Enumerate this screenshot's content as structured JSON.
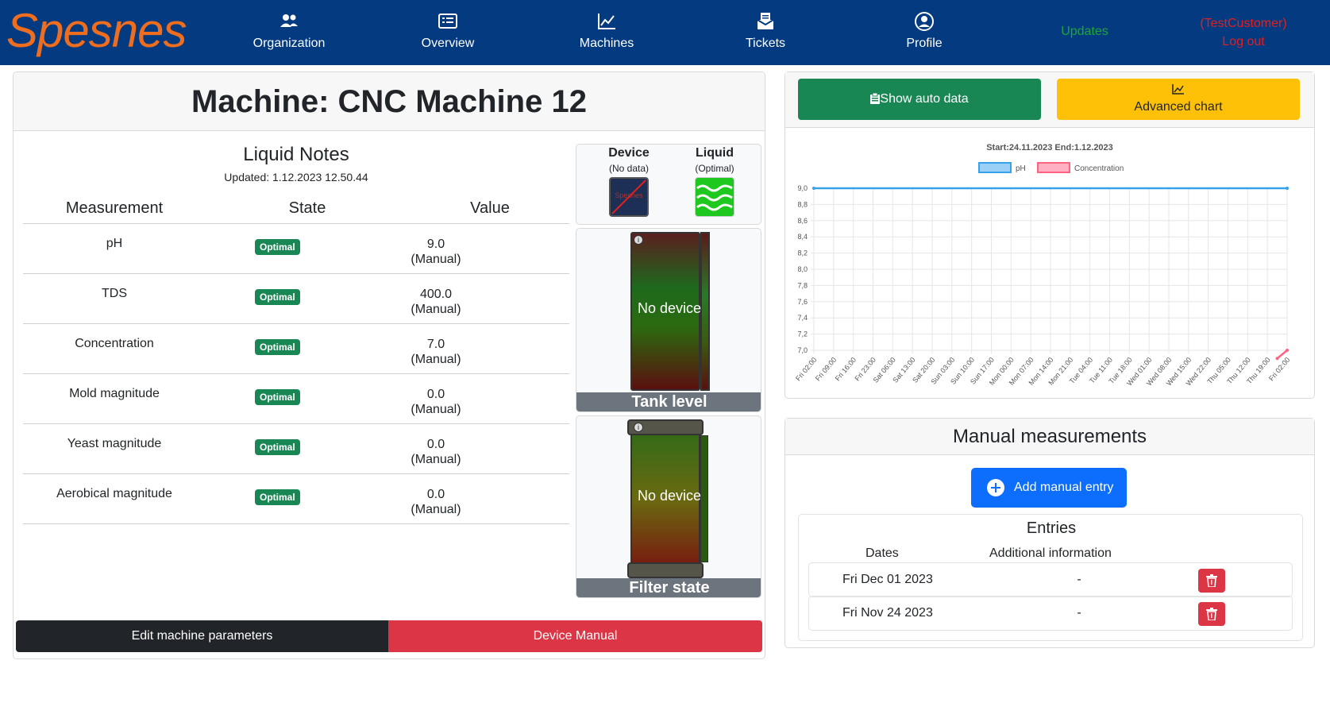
{
  "nav": {
    "brand": "Spesnes",
    "items": [
      {
        "label": "Organization",
        "icon": "users-icon"
      },
      {
        "label": "Overview",
        "icon": "list-card-icon"
      },
      {
        "label": "Machines",
        "icon": "line-chart-icon"
      },
      {
        "label": "Tickets",
        "icon": "ticket-icon"
      },
      {
        "label": "Profile",
        "icon": "user-circle-icon"
      }
    ],
    "updates": "Updates",
    "customer": "(TestCustomer)",
    "logout": "Log out"
  },
  "machine": {
    "title": "Machine: CNC Machine 12",
    "notes_title": "Liquid Notes",
    "updated": "Updated: 1.12.2023 12.50.44",
    "headers": {
      "measurement": "Measurement",
      "state": "State",
      "value": "Value"
    },
    "rows": [
      {
        "measurement": "pH",
        "state": "Optimal",
        "value": "9.0",
        "source": "(Manual)"
      },
      {
        "measurement": "TDS",
        "state": "Optimal",
        "value": "400.0",
        "source": "(Manual)"
      },
      {
        "measurement": "Concentration",
        "state": "Optimal",
        "value": "7.0",
        "source": "(Manual)"
      },
      {
        "measurement": "Mold magnitude",
        "state": "Optimal",
        "value": "0.0",
        "source": "(Manual)"
      },
      {
        "measurement": "Yeast magnitude",
        "state": "Optimal",
        "value": "0.0",
        "source": "(Manual)"
      },
      {
        "measurement": "Aerobical magnitude",
        "state": "Optimal",
        "value": "0.0",
        "source": "(Manual)"
      }
    ],
    "device": {
      "title": "Device",
      "status": "(No data)",
      "icon_text": "Spesnes"
    },
    "liquid": {
      "title": "Liquid",
      "status": "(Optimal)"
    },
    "tank": {
      "text": "No device",
      "label": "Tank level"
    },
    "filter": {
      "text": "No device",
      "label": "Filter state"
    },
    "edit_button": "Edit machine parameters",
    "manual_button": "Device Manual"
  },
  "chart_panel": {
    "show_auto": "Show auto data",
    "advanced": "Advanced chart"
  },
  "chart_data": {
    "type": "line",
    "title": "Start:24.11.2023  End:1.12.2023",
    "legend": [
      "pH",
      "Concentration"
    ],
    "legend_position": "top",
    "colors": {
      "pH": "#36a2eb",
      "Concentration": "#ff6384"
    },
    "ylim": [
      7.0,
      9.0
    ],
    "yticks": [
      "9,0",
      "8,8",
      "8,6",
      "8,4",
      "8,2",
      "8,0",
      "7,8",
      "7,6",
      "7,4",
      "7,2",
      "7,0"
    ],
    "xticks": [
      "Fri 02:00",
      "Fri 09:00",
      "Fri 16:00",
      "Fri 23:00",
      "Sat 06:00",
      "Sat 13:00",
      "Sat 20:00",
      "Sun 03:00",
      "Sun 10:00",
      "Sun 17:00",
      "Mon 00:00",
      "Mon 07:00",
      "Mon 14:00",
      "Mon 21:00",
      "Tue 04:00",
      "Tue 11:00",
      "Tue 18:00",
      "Wed 01:00",
      "Wed 08:00",
      "Wed 15:00",
      "Wed 22:00",
      "Thu 05:00",
      "Thu 12:00",
      "Thu 19:00",
      "Fri 02:00"
    ],
    "grid": true,
    "series": [
      {
        "name": "pH",
        "x_index": [
          0,
          24
        ],
        "values": [
          9.0,
          9.0
        ]
      },
      {
        "name": "Concentration",
        "x_index": [
          23.5,
          24
        ],
        "values": [
          6.9,
          7.0
        ]
      }
    ]
  },
  "manual": {
    "title": "Manual measurements",
    "add_button": "Add manual entry",
    "entries_title": "Entries",
    "col_dates": "Dates",
    "col_info": "Additional information",
    "entries": [
      {
        "date": "Fri Dec 01 2023",
        "info": "-"
      },
      {
        "date": "Fri Nov 24 2023",
        "info": "-"
      }
    ]
  }
}
